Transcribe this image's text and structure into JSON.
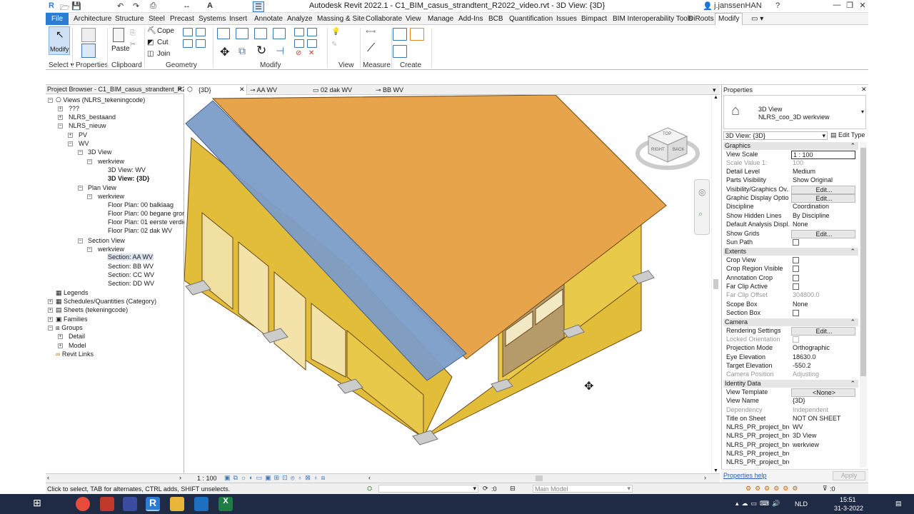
{
  "app": {
    "title": "Autodesk Revit 2022.1 - C1_BIM_casus_strandtent_R2022_video.rvt - 3D View: {3D}",
    "user": "j.janssenHAN"
  },
  "ribbon_tabs": [
    "File",
    "Architecture",
    "Structure",
    "Steel",
    "Precast",
    "Systems",
    "Insert",
    "Annotate",
    "Analyze",
    "Massing & Site",
    "Collaborate",
    "View",
    "Manage",
    "Add-Ins",
    "BCB",
    "Quantification",
    "Issues",
    "Bimpact",
    "BIM Interoperability Tools",
    "DiRoots",
    "Modify"
  ],
  "ribbon": {
    "modify_label": "Modify",
    "properties_label": "Properties",
    "paste_label": "Paste",
    "cope_label": "Cope",
    "cut_label": "Cut",
    "join_label": "Join",
    "groups": [
      "Select",
      "Properties",
      "Clipboard",
      "Geometry",
      "Modify",
      "View",
      "Measure",
      "Create"
    ]
  },
  "project_browser": {
    "title": "Project Browser - C1_BIM_casus_strandtent_R2...",
    "items": [
      {
        "label": "Views (NLRS_tekeningcode)"
      },
      {
        "label": "???"
      },
      {
        "label": "NLRS_bestaand"
      },
      {
        "label": "NLRS_nieuw"
      },
      {
        "label": "PV"
      },
      {
        "label": "WV"
      },
      {
        "label": "3D View"
      },
      {
        "label": "werkview"
      },
      {
        "label": "3D View: WV"
      },
      {
        "label": "3D View: {3D}"
      },
      {
        "label": "Plan View"
      },
      {
        "label": "werkview"
      },
      {
        "label": "Floor Plan: 00 balklaag"
      },
      {
        "label": "Floor Plan: 00 begane grond"
      },
      {
        "label": "Floor Plan: 01 eerste verdiepi"
      },
      {
        "label": "Floor Plan: 02 dak WV"
      },
      {
        "label": "Section View"
      },
      {
        "label": "werkview"
      },
      {
        "label": "Section: AA WV"
      },
      {
        "label": "Section: BB WV"
      },
      {
        "label": "Section: CC WV"
      },
      {
        "label": "Section: DD WV"
      },
      {
        "label": "Legends"
      },
      {
        "label": "Schedules/Quantities (Category)"
      },
      {
        "label": "Sheets (tekeningcode)"
      },
      {
        "label": "Families"
      },
      {
        "label": "Groups"
      },
      {
        "label": "Detail"
      },
      {
        "label": "Model"
      },
      {
        "label": "Revit Links"
      }
    ]
  },
  "view_tabs": [
    "{3D}",
    "AA WV",
    "02 dak WV",
    "BB WV"
  ],
  "view_control": {
    "scale": "1 : 100"
  },
  "viewcube": {
    "top": "TOP",
    "front": "RIGHT",
    "back": "BACK"
  },
  "properties": {
    "title": "Properties",
    "type_name": "3D View",
    "type_sub": "NLRS_coo_3D werkview",
    "selector": "3D View: {3D}",
    "edit_type": "Edit Type",
    "categories": {
      "graphics": "Graphics",
      "extents": "Extents",
      "camera": "Camera",
      "identity": "Identity Data"
    },
    "graphics_rows": [
      {
        "k": "View Scale",
        "v": "1 : 100"
      },
      {
        "k": "Scale Value    1:",
        "v": "100"
      },
      {
        "k": "Detail Level",
        "v": "Medium"
      },
      {
        "k": "Parts Visibility",
        "v": "Show Original"
      },
      {
        "k": "Visibility/Graphics Ov...",
        "v": "Edit..."
      },
      {
        "k": "Graphic Display Optio...",
        "v": "Edit..."
      },
      {
        "k": "Discipline",
        "v": "Coordination"
      },
      {
        "k": "Show Hidden Lines",
        "v": "By Discipline"
      },
      {
        "k": "Default Analysis Displ...",
        "v": "None"
      },
      {
        "k": "Show Grids",
        "v": "Edit..."
      },
      {
        "k": "Sun Path",
        "v": ""
      }
    ],
    "extents_rows": [
      {
        "k": "Crop View",
        "v": ""
      },
      {
        "k": "Crop Region Visible",
        "v": ""
      },
      {
        "k": "Annotation Crop",
        "v": ""
      },
      {
        "k": "Far Clip Active",
        "v": ""
      },
      {
        "k": "Far Clip Offset",
        "v": "304800.0"
      },
      {
        "k": "Scope Box",
        "v": "None"
      },
      {
        "k": "Section Box",
        "v": ""
      }
    ],
    "camera_rows": [
      {
        "k": "Rendering Settings",
        "v": "Edit..."
      },
      {
        "k": "Locked Orientation",
        "v": ""
      },
      {
        "k": "Projection Mode",
        "v": "Orthographic"
      },
      {
        "k": "Eye Elevation",
        "v": "18630.0"
      },
      {
        "k": "Target Elevation",
        "v": "-550.2"
      },
      {
        "k": "Camera Position",
        "v": "Adjusting"
      }
    ],
    "identity_rows": [
      {
        "k": "View Template",
        "v": "<None>"
      },
      {
        "k": "View Name",
        "v": "{3D}"
      },
      {
        "k": "Dependency",
        "v": "Independent"
      },
      {
        "k": "Title on Sheet",
        "v": "NOT ON SHEET"
      },
      {
        "k": "NLRS_PR_project_bro...",
        "v": "WV"
      },
      {
        "k": "NLRS_PR_project_bro...",
        "v": "3D View"
      },
      {
        "k": "NLRS_PR_project_bro...",
        "v": "werkview"
      },
      {
        "k": "NLRS_PR_project_bro...",
        "v": ""
      },
      {
        "k": "NLRS_PR_project_bro...",
        "v": ""
      }
    ],
    "help": "Properties help",
    "apply": "Apply"
  },
  "status": {
    "hint": "Click to select, TAB for alternates, CTRL adds, SHIFT unselects.",
    "zero": ":0",
    "model": "Main Model",
    "filter": ":0"
  },
  "taskbar": {
    "lang": "NLD",
    "time": "15:51",
    "date": "31-3-2022"
  },
  "colors": {
    "roof": "#e8a44a",
    "solar": "#7c9dc9",
    "wall": "#e8c94a",
    "accent": "#2b7cd3"
  }
}
